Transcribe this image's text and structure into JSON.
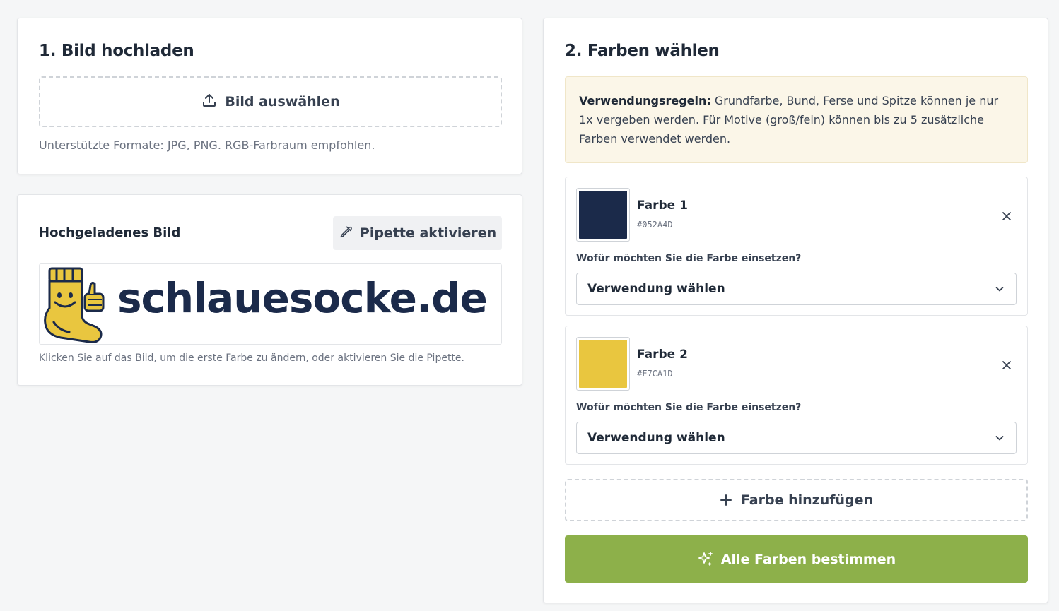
{
  "upload": {
    "title": "1. Bild hochladen",
    "button_label": "Bild auswählen",
    "hint": "Unterstützte Formate: JPG, PNG. RGB-Farbraum empfohlen."
  },
  "preview": {
    "title": "Hochgeladenes Bild",
    "pipette_label": "Pipette aktivieren",
    "logo_text": "schlauesocke.de",
    "hint": "Klicken Sie auf das Bild, um die erste Farbe zu ändern, oder aktivieren Sie die Pipette."
  },
  "colors": {
    "title": "2. Farben wählen",
    "rules_label": "Verwendungsregeln:",
    "rules_text": " Grundfarbe, Bund, Ferse und Spitze können je nur 1x vergeben werden. Für Motive (groß/fein) können bis zu 5 zusätzliche Farben verwendet werden.",
    "items": [
      {
        "name": "Farbe 1",
        "hex": "#052A4D",
        "swatch": "#1b2a4a",
        "question": "Wofür möchten Sie die Farbe einsetzen?",
        "select_value": "Verwendung wählen"
      },
      {
        "name": "Farbe 2",
        "hex": "#F7CA1D",
        "swatch": "#e9c63f",
        "question": "Wofür möchten Sie die Farbe einsetzen?",
        "select_value": "Verwendung wählen"
      }
    ],
    "add_label": "Farbe hinzufügen",
    "submit_label": "Alle Farben bestimmen"
  },
  "icons": {
    "upload": "upload-icon",
    "pipette": "pipette-icon",
    "close": "close-icon",
    "chevron": "chevron-down-icon",
    "plus": "plus-icon",
    "sparkle": "sparkle-icon"
  },
  "theme": {
    "primary": "#8db04a",
    "notice_bg": "#fbf6e8"
  }
}
